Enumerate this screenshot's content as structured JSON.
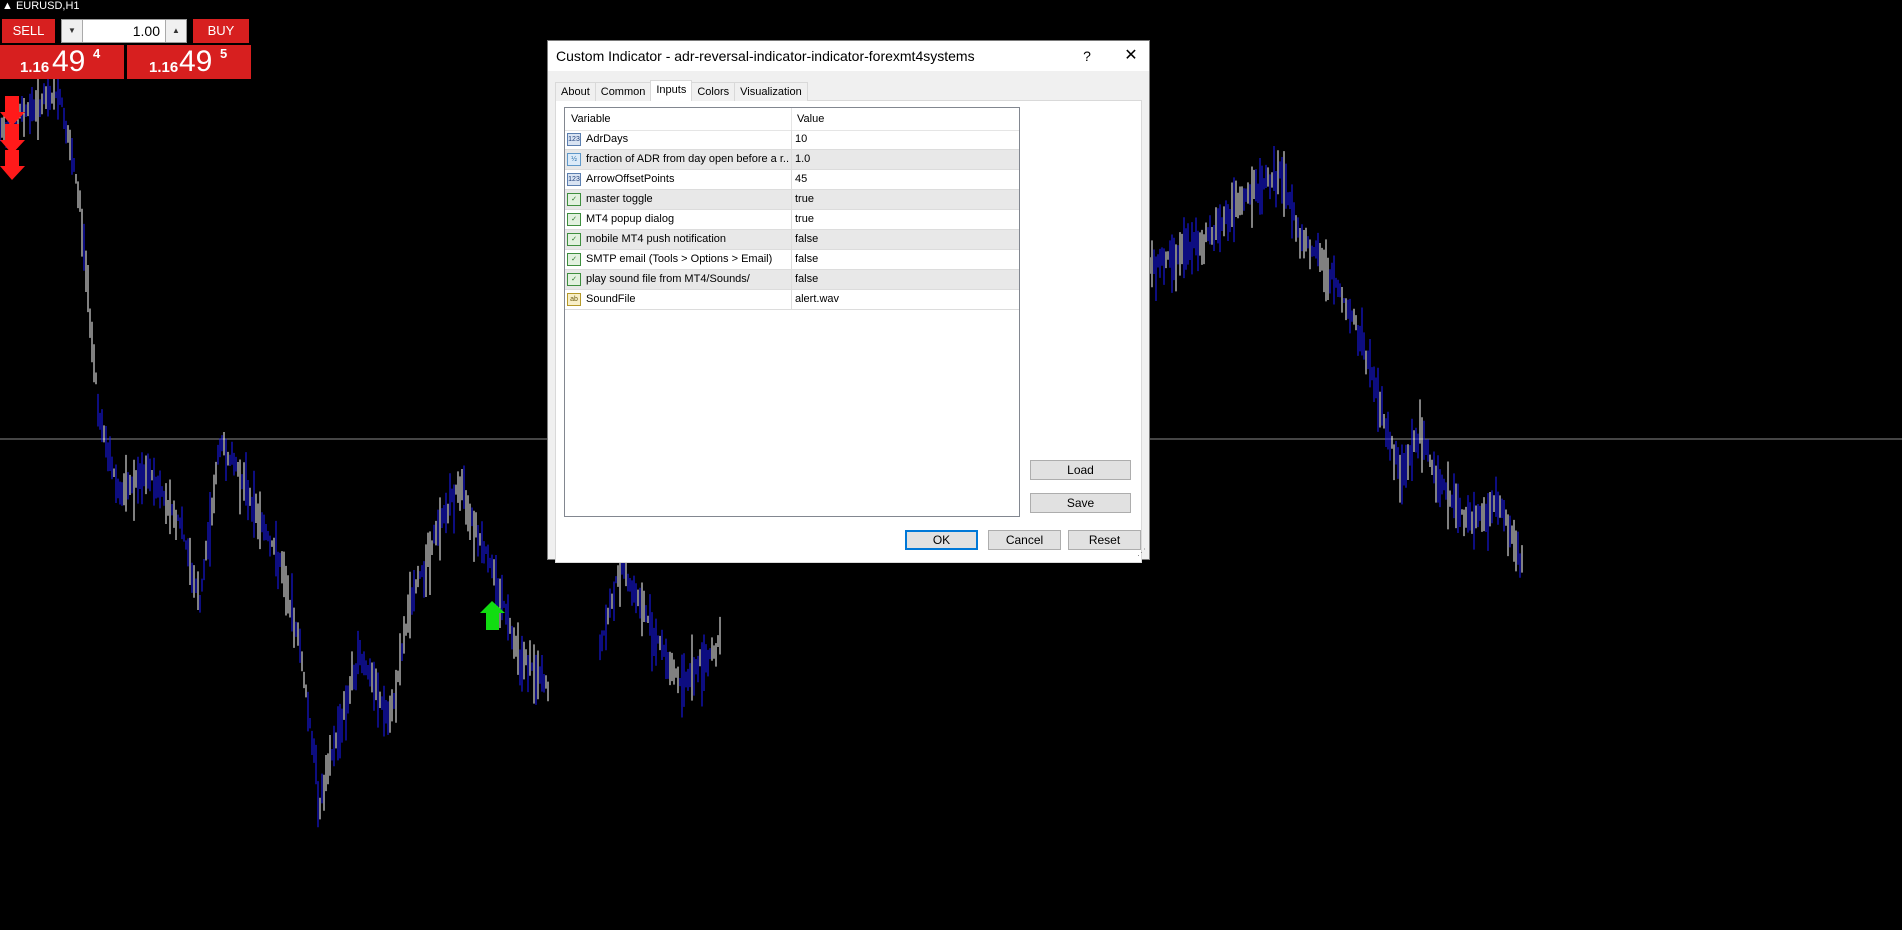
{
  "chart": {
    "symbol": "EURUSD,H1",
    "line_color": "#1a1aff",
    "background": "#000000"
  },
  "trade_panel": {
    "sell_label": "SELL",
    "buy_label": "BUY",
    "lot_value": "1.00",
    "lot_down_icon": "arrow-down",
    "lot_up_icon": "arrow-up",
    "sell_price_small": "1.16",
    "sell_price_big": "49",
    "sell_price_sup": "4",
    "buy_price_small": "1.16",
    "buy_price_big": "49",
    "buy_price_sup": "5",
    "color": "#d71f1f"
  },
  "dialog": {
    "title": "Custom Indicator - adr-reversal-indicator-indicator-forexmt4systems",
    "help_label": "?",
    "close_label": "✕",
    "tabs": [
      {
        "label": "About"
      },
      {
        "label": "Common"
      },
      {
        "label": "Inputs"
      },
      {
        "label": "Colors"
      },
      {
        "label": "Visualization"
      }
    ],
    "active_tab": "Inputs",
    "grid": {
      "col_variable": "Variable",
      "col_value": "Value",
      "rows": [
        {
          "icon": "int-icon",
          "badge": "123",
          "name": "AdrDays",
          "value": "10"
        },
        {
          "icon": "double-icon",
          "badge": "½",
          "name": "fraction of ADR from day open before a r...",
          "value": "1.0"
        },
        {
          "icon": "int-icon",
          "badge": "123",
          "name": "ArrowOffsetPoints",
          "value": "45"
        },
        {
          "icon": "bool-icon",
          "badge": "✓",
          "name": "master toggle",
          "value": "true"
        },
        {
          "icon": "bool-icon",
          "badge": "✓",
          "name": "MT4 popup dialog",
          "value": "true"
        },
        {
          "icon": "bool-icon",
          "badge": "✓",
          "name": "mobile MT4 push notification",
          "value": "false"
        },
        {
          "icon": "bool-icon",
          "badge": "✓",
          "name": "SMTP email (Tools > Options > Email)",
          "value": "false"
        },
        {
          "icon": "bool-icon",
          "badge": "✓",
          "name": "play sound file from MT4/Sounds/",
          "value": "false"
        },
        {
          "icon": "string-icon",
          "badge": "ab",
          "name": "SoundFile",
          "value": "alert.wav"
        }
      ]
    },
    "load_label": "Load",
    "save_label": "Save",
    "ok_label": "OK",
    "cancel_label": "Cancel",
    "reset_label": "Reset"
  }
}
